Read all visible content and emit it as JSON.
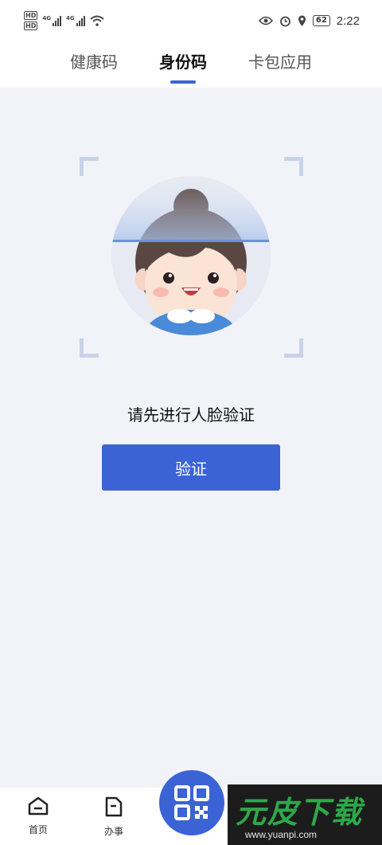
{
  "status_bar": {
    "hd_badges": [
      "HD",
      "HD"
    ],
    "network_1": "4G",
    "network_2": "4G",
    "battery": "62",
    "time": "2:22"
  },
  "tabs": [
    {
      "label": "健康码",
      "active": false
    },
    {
      "label": "身份码",
      "active": true
    },
    {
      "label": "卡包应用",
      "active": false
    }
  ],
  "main": {
    "prompt": "请先进行人脸验证",
    "verify_button": "验证"
  },
  "bottom_nav": {
    "home_label": "首页",
    "work_label": "办事"
  },
  "watermark": {
    "title": "元皮下载",
    "url": "www.yuanpi.com"
  },
  "colors": {
    "accent": "#3b63d6",
    "background": "#f1f3f8"
  }
}
